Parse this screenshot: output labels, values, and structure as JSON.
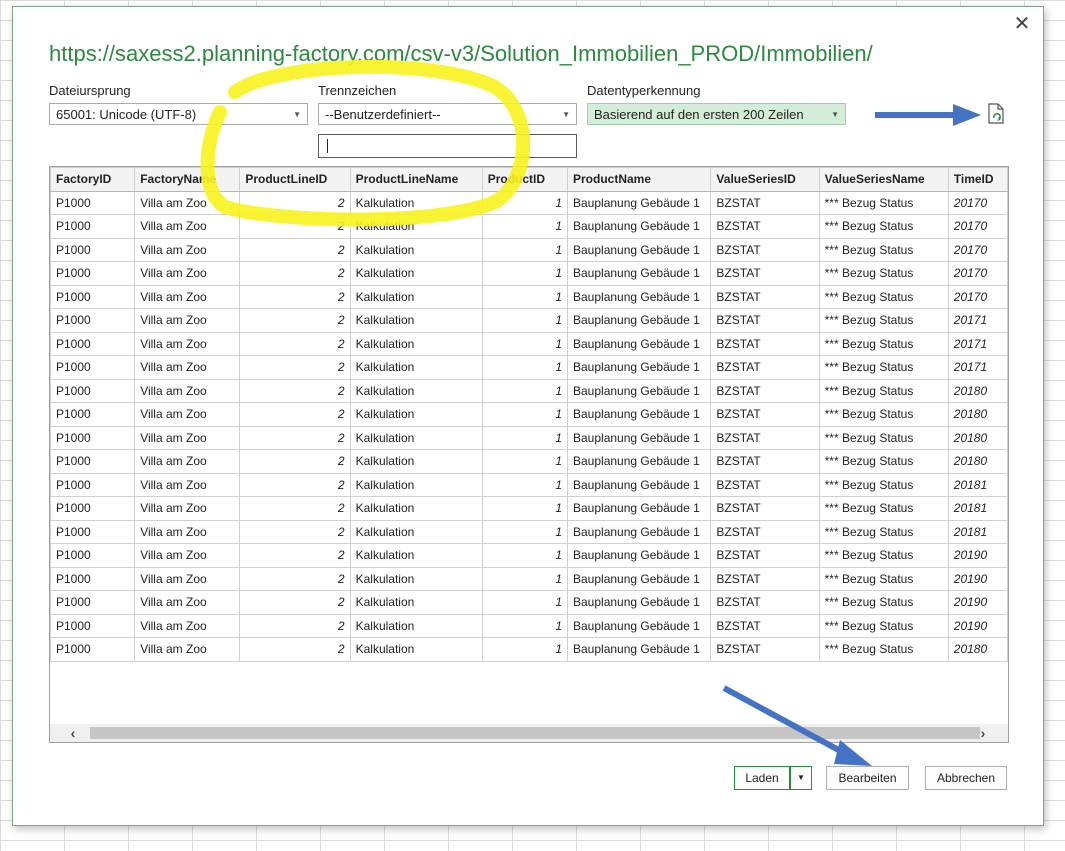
{
  "dialog": {
    "url": "https://saxess2.planning-factory.com/csv-v3/Solution_Immobilien_PROD/Immobilien/",
    "close_icon": "close-icon",
    "close_glyph": "✕"
  },
  "fields": {
    "origin": {
      "label": "Dateiursprung",
      "value": "65001: Unicode (UTF-8)"
    },
    "delimiter": {
      "label": "Trennzeichen",
      "value": "--Benutzerdefiniert--",
      "custom_value": ""
    },
    "detection": {
      "label": "Datentyperkennung",
      "value": "Basierend auf den ersten 200 Zeilen"
    }
  },
  "table": {
    "columns": [
      "FactoryID",
      "FactoryName",
      "ProductLineID",
      "ProductLineName",
      "ProductID",
      "ProductName",
      "ValueSeriesID",
      "ValueSeriesName",
      "TimeID"
    ],
    "rows": [
      [
        "P1000",
        "Villa am Zoo",
        "2",
        "Kalkulation",
        "1",
        "Bauplanung Gebäude 1",
        "BZSTAT",
        "*** Bezug Status",
        "20170"
      ],
      [
        "P1000",
        "Villa am Zoo",
        "2",
        "Kalkulation",
        "1",
        "Bauplanung Gebäude 1",
        "BZSTAT",
        "*** Bezug Status",
        "20170"
      ],
      [
        "P1000",
        "Villa am Zoo",
        "2",
        "Kalkulation",
        "1",
        "Bauplanung Gebäude 1",
        "BZSTAT",
        "*** Bezug Status",
        "20170"
      ],
      [
        "P1000",
        "Villa am Zoo",
        "2",
        "Kalkulation",
        "1",
        "Bauplanung Gebäude 1",
        "BZSTAT",
        "*** Bezug Status",
        "20170"
      ],
      [
        "P1000",
        "Villa am Zoo",
        "2",
        "Kalkulation",
        "1",
        "Bauplanung Gebäude 1",
        "BZSTAT",
        "*** Bezug Status",
        "20170"
      ],
      [
        "P1000",
        "Villa am Zoo",
        "2",
        "Kalkulation",
        "1",
        "Bauplanung Gebäude 1",
        "BZSTAT",
        "*** Bezug Status",
        "20171"
      ],
      [
        "P1000",
        "Villa am Zoo",
        "2",
        "Kalkulation",
        "1",
        "Bauplanung Gebäude 1",
        "BZSTAT",
        "*** Bezug Status",
        "20171"
      ],
      [
        "P1000",
        "Villa am Zoo",
        "2",
        "Kalkulation",
        "1",
        "Bauplanung Gebäude 1",
        "BZSTAT",
        "*** Bezug Status",
        "20171"
      ],
      [
        "P1000",
        "Villa am Zoo",
        "2",
        "Kalkulation",
        "1",
        "Bauplanung Gebäude 1",
        "BZSTAT",
        "*** Bezug Status",
        "20180"
      ],
      [
        "P1000",
        "Villa am Zoo",
        "2",
        "Kalkulation",
        "1",
        "Bauplanung Gebäude 1",
        "BZSTAT",
        "*** Bezug Status",
        "20180"
      ],
      [
        "P1000",
        "Villa am Zoo",
        "2",
        "Kalkulation",
        "1",
        "Bauplanung Gebäude 1",
        "BZSTAT",
        "*** Bezug Status",
        "20180"
      ],
      [
        "P1000",
        "Villa am Zoo",
        "2",
        "Kalkulation",
        "1",
        "Bauplanung Gebäude 1",
        "BZSTAT",
        "*** Bezug Status",
        "20180"
      ],
      [
        "P1000",
        "Villa am Zoo",
        "2",
        "Kalkulation",
        "1",
        "Bauplanung Gebäude 1",
        "BZSTAT",
        "*** Bezug Status",
        "20181"
      ],
      [
        "P1000",
        "Villa am Zoo",
        "2",
        "Kalkulation",
        "1",
        "Bauplanung Gebäude 1",
        "BZSTAT",
        "*** Bezug Status",
        "20181"
      ],
      [
        "P1000",
        "Villa am Zoo",
        "2",
        "Kalkulation",
        "1",
        "Bauplanung Gebäude 1",
        "BZSTAT",
        "*** Bezug Status",
        "20181"
      ],
      [
        "P1000",
        "Villa am Zoo",
        "2",
        "Kalkulation",
        "1",
        "Bauplanung Gebäude 1",
        "BZSTAT",
        "*** Bezug Status",
        "20190"
      ],
      [
        "P1000",
        "Villa am Zoo",
        "2",
        "Kalkulation",
        "1",
        "Bauplanung Gebäude 1",
        "BZSTAT",
        "*** Bezug Status",
        "20190"
      ],
      [
        "P1000",
        "Villa am Zoo",
        "2",
        "Kalkulation",
        "1",
        "Bauplanung Gebäude 1",
        "BZSTAT",
        "*** Bezug Status",
        "20190"
      ],
      [
        "P1000",
        "Villa am Zoo",
        "2",
        "Kalkulation",
        "1",
        "Bauplanung Gebäude 1",
        "BZSTAT",
        "*** Bezug Status",
        "20190"
      ],
      [
        "P1000",
        "Villa am Zoo",
        "2",
        "Kalkulation",
        "1",
        "Bauplanung Gebäude 1",
        "BZSTAT",
        "*** Bezug Status",
        "20180"
      ]
    ]
  },
  "buttons": {
    "load": "Laden",
    "edit": "Bearbeiten",
    "cancel": "Abbrechen"
  },
  "icons": {
    "dropdown": "chevron-down-icon",
    "refresh": "refresh-file-icon",
    "scroll_left": "chevron-left-icon",
    "scroll_right": "chevron-right-icon"
  },
  "colors": {
    "accent": "#2b8a3e",
    "highlight": "#f7f31e",
    "annotation_arrow": "#4472c4"
  }
}
